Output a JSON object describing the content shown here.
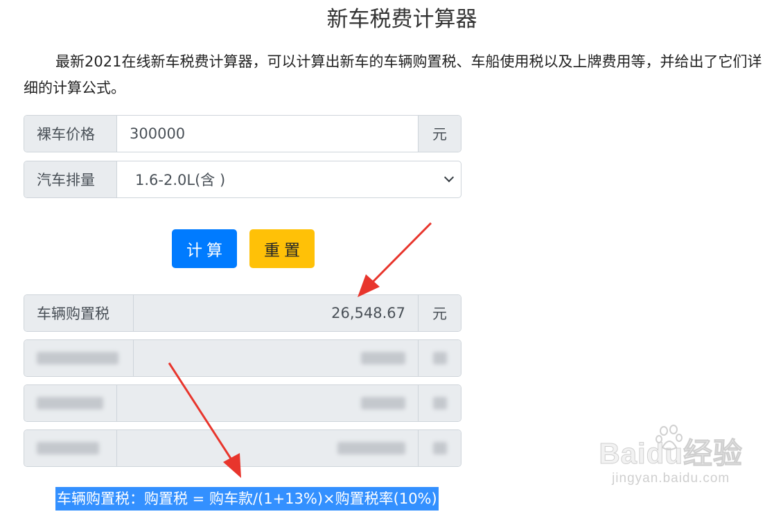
{
  "page": {
    "title": "新车税费计算器",
    "intro": "最新2021在线新车税费计算器，可以计算出新车的车辆购置税、车船使用税以及上牌费用等，并给出了它们详细的计算公式。"
  },
  "form": {
    "price_label": "裸车价格",
    "price_value": "300000",
    "price_unit": "元",
    "displacement_label": "汽车排量",
    "displacement_selected": "1.6-2.0L(含 )"
  },
  "buttons": {
    "calculate": "计算",
    "reset": "重置"
  },
  "results": {
    "purchase_tax_label": "车辆购置税",
    "purchase_tax_value": "26,548.67",
    "purchase_tax_unit": "元"
  },
  "formula": "车辆购置税：购置税 = 购车款/(1+13%)×购置税率(10%)",
  "watermark": {
    "logo": "Baidu经验",
    "url": "jingyan.baidu.com"
  },
  "colors": {
    "primary": "#007bff",
    "warning": "#ffc107",
    "addon_bg": "#e9ecef",
    "arrow": "#e8352c",
    "highlight": "#3390ff"
  }
}
